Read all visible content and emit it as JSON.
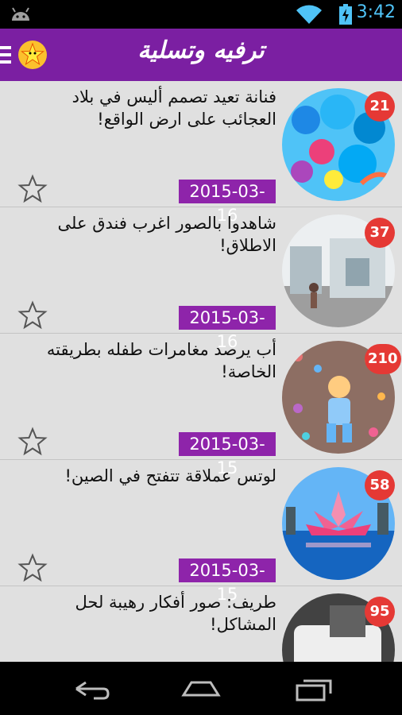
{
  "status_bar": {
    "time": "3:42",
    "icons": [
      "android-debug-icon",
      "wifi-icon",
      "battery-icon"
    ]
  },
  "app_bar": {
    "title": "ترفيه وتسلية",
    "icons": [
      "menu-icon",
      "star-logo-icon"
    ]
  },
  "articles": [
    {
      "title": "فنانة تعيد تصمم أليس في بلاد العجائب على ارض الواقع!",
      "date": "2015-03-16",
      "count": "21"
    },
    {
      "title": "شاهدوا بالصور اغرب فندق على الاطلاق!",
      "date": "2015-03-16",
      "count": "37"
    },
    {
      "title": "أب يرصد مغامرات طفله بطريقته الخاصة!",
      "date": "2015-03-15",
      "count": "210"
    },
    {
      "title": "لوتس عملاقة تتفتح في الصين!",
      "date": "2015-03-15",
      "count": "58"
    },
    {
      "title": "طريف: صور أفكار رهيبة لحل المشاكل!",
      "date": "",
      "count": "95"
    }
  ],
  "nav_bar": {
    "icons": [
      "back-icon",
      "home-icon",
      "recent-apps-icon"
    ]
  },
  "colors": {
    "app_bar": "#7b1fa2",
    "date_badge": "#8e24aa",
    "count_badge": "#e53935",
    "list_bg": "#e0e0e0"
  }
}
